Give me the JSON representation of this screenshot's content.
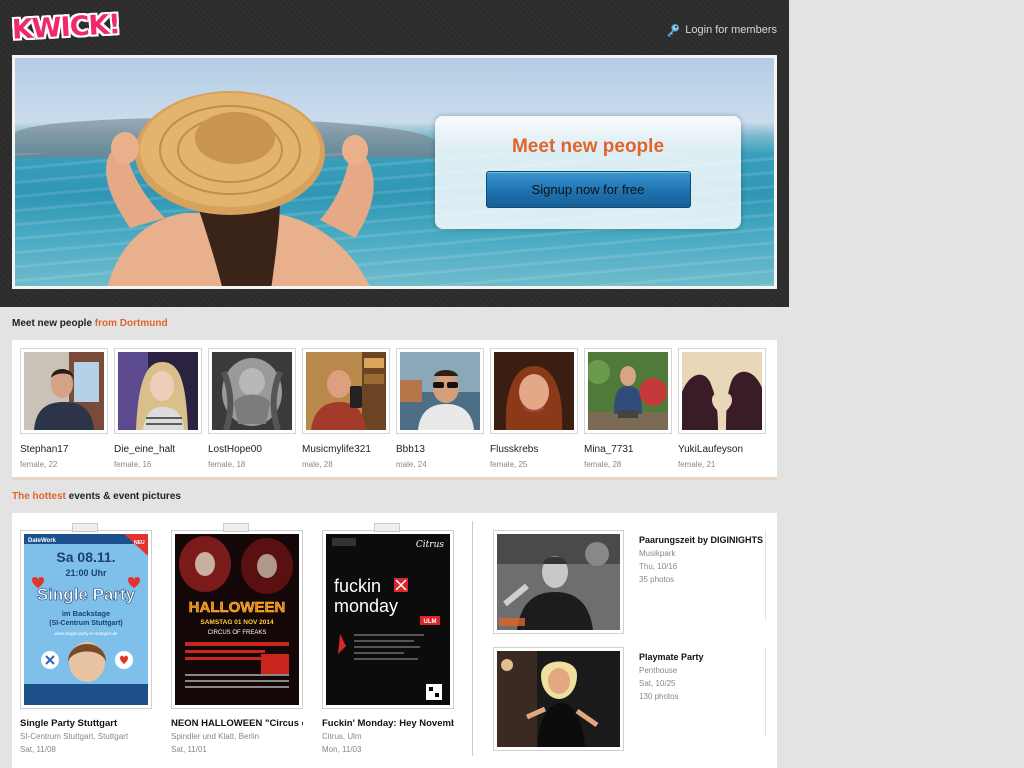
{
  "header": {
    "logo_text": "KWICK!",
    "login_label": "Login for members"
  },
  "hero": {
    "headline": "Meet new people",
    "cta_label": "Signup now for free"
  },
  "people_section": {
    "title_prefix": "Meet new people",
    "title_highlight": "from Dortmund"
  },
  "people": [
    {
      "name": "Stephan17",
      "meta": "female, 22"
    },
    {
      "name": "Die_eine_halt",
      "meta": "female, 16"
    },
    {
      "name": "LostHope00",
      "meta": "female, 18"
    },
    {
      "name": "Musicmylife321",
      "meta": "male, 28"
    },
    {
      "name": "Bbb13",
      "meta": "male, 24"
    },
    {
      "name": "Flusskrebs",
      "meta": "female, 25"
    },
    {
      "name": "Mina_7731",
      "meta": "female, 28"
    },
    {
      "name": "YukiLaufeyson",
      "meta": "female, 21"
    }
  ],
  "events_section": {
    "title_highlight": "The hottest",
    "title_suffix": "events & event pictures"
  },
  "events": [
    {
      "title": "Single Party Stuttgart",
      "venue": "SI-Centrum Stuttgart, Stuttgart",
      "date": "Sat, 11/08",
      "flyer_brand": "DateWork",
      "flyer_badge": "NEU",
      "flyer_date": "Sa 08.11.",
      "flyer_time": "21:00 Uhr",
      "flyer_headline": "Single Party",
      "flyer_place_1": "im Backstage",
      "flyer_place_2": "(SI-Centrum Stuttgart)",
      "flyer_url": "www.single-party-in-stuttgart.de"
    },
    {
      "title": "NEON HALLOWEEN \"Circus of Freaks\"",
      "venue": "Spindler und Klatt, Berlin",
      "date": "Sat, 11/01",
      "flyer_headline": "HALLOWEEN",
      "flyer_date": "SAMSTAG 01 NOV 2014",
      "flyer_sub": "CIRCUS OF FREAKS"
    },
    {
      "title": "Fuckin' Monday: Hey November",
      "venue": "Citrus, Ulm",
      "date": "Mon, 11/03",
      "flyer_brand": "Citrus",
      "flyer_line_1": "fuckin",
      "flyer_line_2": "monday",
      "flyer_tag": "ULM"
    }
  ],
  "galleries": [
    {
      "title": "Paarungszeit by DIGINIGHTS",
      "venue": "Musikpark",
      "date": "Thu, 10/16",
      "photos": "35 photos"
    },
    {
      "title": "Playmate Party",
      "venue": "Penthouse",
      "date": "Sat, 10/25",
      "photos": "130 photos"
    }
  ],
  "colors": {
    "accent": "#e0642b",
    "cta_blue": "#1e72b0",
    "header_bg": "#2b2b2b",
    "page_bg": "#e3e3e3"
  }
}
